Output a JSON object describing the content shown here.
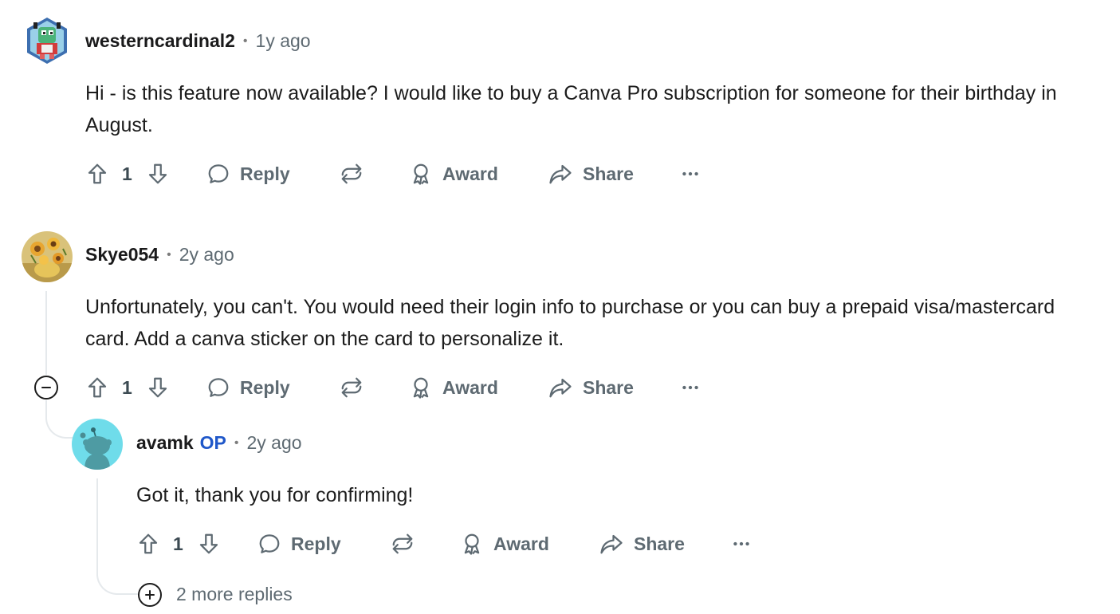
{
  "comments": [
    {
      "username": "westerncardinal2",
      "time": "1y ago",
      "body": "Hi - is this feature now available? I would like to buy a Canva Pro subscription for someone for their birthday in August.",
      "votes": "1",
      "avatar": "pixel-avatar"
    },
    {
      "username": "Skye054",
      "time": "2y ago",
      "body": "Unfortunately, you can't. You would need their login info to purchase or you can buy a prepaid visa/mastercard card. Add a canva sticker on the card to personalize it.",
      "votes": "1",
      "avatar": "sunflower-painting-avatar"
    },
    {
      "username": "avamk",
      "op_badge": "OP",
      "time": "2y ago",
      "body": "Got it, thank you for confirming!",
      "votes": "1",
      "avatar": "reddit-snoo-avatar"
    }
  ],
  "actions": {
    "reply": "Reply",
    "award": "Award",
    "share": "Share"
  },
  "more_replies": "2 more replies",
  "colors": {
    "text_muted": "#5e6a72",
    "op_blue": "#1f57c9",
    "thread_line": "#e5e9ec",
    "snoo_bg": "#6fdcea"
  }
}
